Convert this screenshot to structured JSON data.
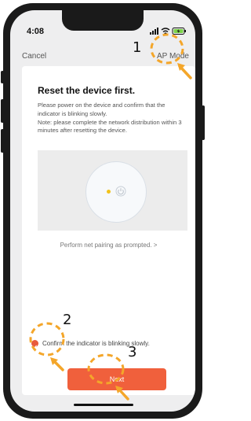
{
  "status_bar": {
    "time": "4:08"
  },
  "nav": {
    "cancel_label": "Cancel",
    "ap_mode_label": "AP Mode"
  },
  "card": {
    "title": "Reset the device first.",
    "description": "Please power on the device and confirm that the indicator is blinking slowly.\nNote: please complete the network distribution within 3 minutes after resetting the device.",
    "prompt_link": "Perform net pairing as prompted. >"
  },
  "confirm": {
    "label": "Confirm the indicator is blinking slowly.",
    "checked": true
  },
  "next_button": {
    "label": "Next"
  },
  "annotations": {
    "step1": "1",
    "step2": "2",
    "step3": "3"
  },
  "colors": {
    "accent": "#f0603c",
    "highlight": "#f4a62a",
    "led": "#f2c21b"
  }
}
